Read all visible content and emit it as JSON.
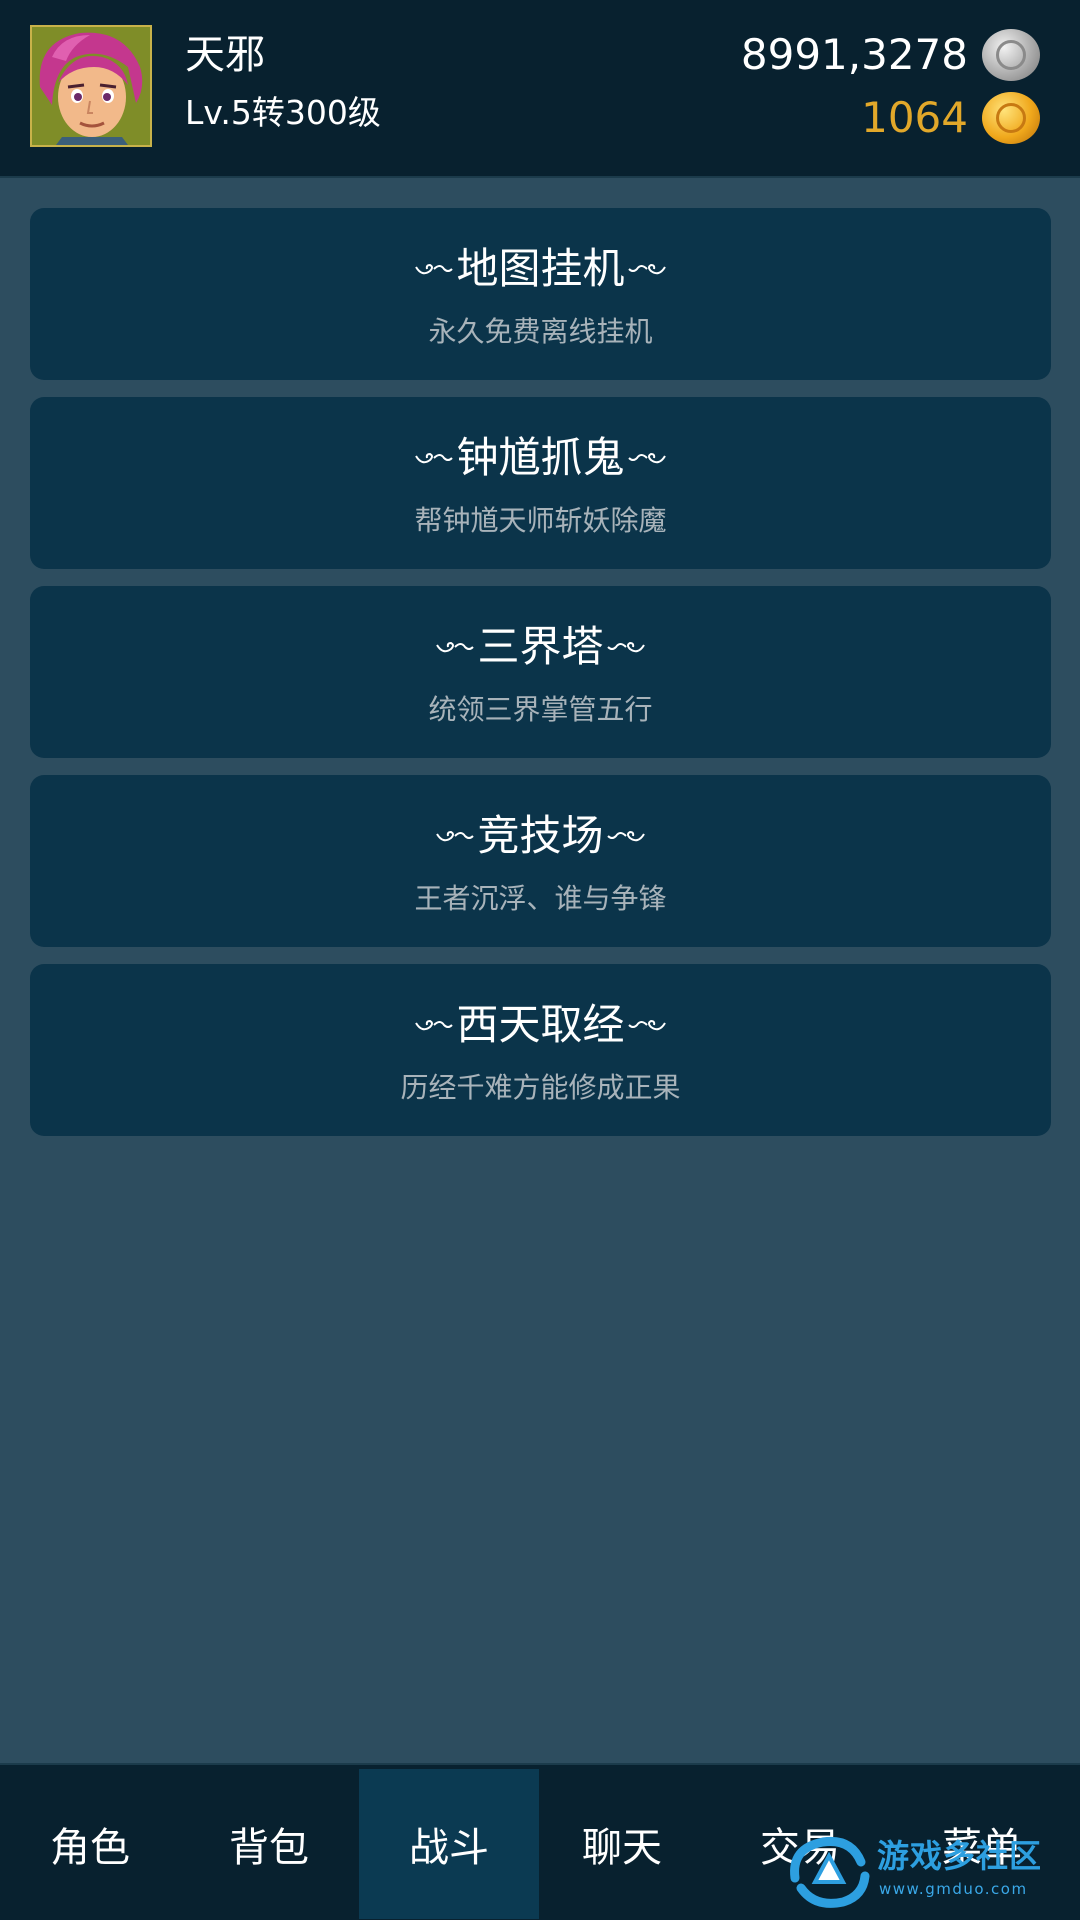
{
  "player": {
    "name": "天邪",
    "level": "Lv.5转300级",
    "avatar": "hero-portrait"
  },
  "currency": {
    "silver": "8991,3278",
    "silver_icon": "silver-coin-icon",
    "gold": "1064",
    "gold_icon": "gold-coin-icon",
    "gold_color": "#e2a82a"
  },
  "menu": [
    {
      "title": "地图挂机",
      "subtitle": "永久免费离线挂机"
    },
    {
      "title": "钟馗抓鬼",
      "subtitle": "帮钟馗天师斩妖除魔"
    },
    {
      "title": "三界塔",
      "subtitle": "统领三界掌管五行"
    },
    {
      "title": "竞技场",
      "subtitle": "王者沉浮、谁与争锋"
    },
    {
      "title": "西天取经",
      "subtitle": "历经千难方能修成正果"
    }
  ],
  "nav": {
    "tabs": [
      "角色",
      "背包",
      "战斗",
      "聊天",
      "交易",
      "菜单"
    ],
    "active": "战斗"
  },
  "watermark": {
    "title": "游戏多社区",
    "url": "www.gmduo.com"
  },
  "colors": {
    "background": "#2d4d5f",
    "bar": "#08212f",
    "card": "#0b344a",
    "active_tab": "#0b3a52"
  }
}
